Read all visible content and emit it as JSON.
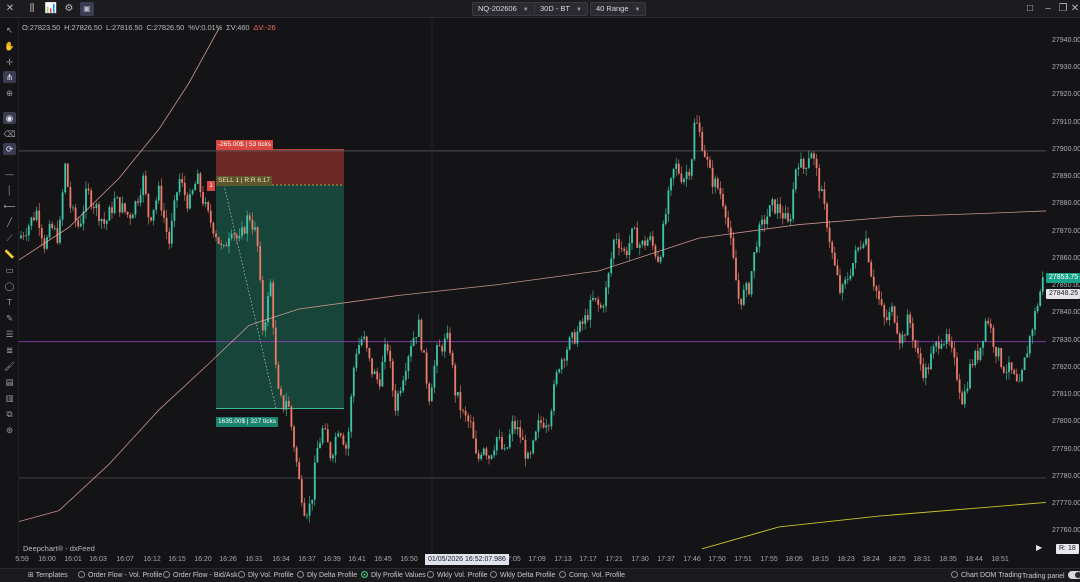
{
  "window": {
    "symbol": "NQ-202606",
    "period": "30D - BT",
    "bar_type": "40 Range"
  },
  "ohlc": {
    "open": "O:27823.50",
    "high": "H:27826.50",
    "low": "L:27816.50",
    "close": "C:27826.50",
    "pct": "%V:0.01%",
    "vol": "ΣV:460",
    "delta": "ΔV:-26"
  },
  "price_axis": {
    "labels": [
      "27940.00",
      "27930.00",
      "27920.00",
      "27910.00",
      "27900.00",
      "27890.00",
      "27880.00",
      "27870.00",
      "27860.00",
      "27850.00",
      "27840.00",
      "27830.00",
      "27820.00",
      "27810.00",
      "27800.00",
      "27790.00",
      "27780.00",
      "27770.00",
      "27760.00"
    ],
    "current_price": "27853.75",
    "cursor_price": "27848.25"
  },
  "time_axis": {
    "labels": [
      "5:59",
      "16:00",
      "16:01",
      "16:03",
      "16:07",
      "16:12",
      "16:15",
      "16:20",
      "16:26",
      "16:31",
      "16:34",
      "16:37",
      "16:39",
      "16:41",
      "16:45",
      "16:50",
      "17:05",
      "17:09",
      "17:13",
      "17:17",
      "17:21",
      "17:30",
      "17:37",
      "17:46",
      "17:50",
      "17:51",
      "17:55",
      "18:05",
      "18:15",
      "18:23",
      "18:24",
      "18:25",
      "18:31",
      "18:35",
      "18:44",
      "18:51"
    ],
    "cursor": "01/05/2026 16:52:07.986"
  },
  "trade": {
    "stop_label": "-265.00$ | 53 ticks",
    "entry_label": "SELL 1 | R:R 6.17",
    "target_label": "1635.00$ | 327 ticks",
    "qty_marker": "1"
  },
  "chart_data": {
    "type": "candlestick",
    "instrument": "NQ-202606",
    "ylim": [
      27755,
      27945
    ],
    "x_range": [
      "15:59",
      "18:52"
    ],
    "horizontal_lines": [
      27900,
      27830,
      27780
    ],
    "trade": {
      "side": "SELL",
      "entry": 27887.5,
      "stop": 27900.5,
      "target": 27805.5,
      "rr": 6.17
    },
    "close_path": [
      [
        0,
        27868
      ],
      [
        8,
        27872
      ],
      [
        18,
        27878
      ],
      [
        26,
        27865
      ],
      [
        32,
        27872
      ],
      [
        40,
        27868
      ],
      [
        46,
        27895
      ],
      [
        52,
        27878
      ],
      [
        60,
        27872
      ],
      [
        68,
        27885
      ],
      [
        76,
        27880
      ],
      [
        86,
        27873
      ],
      [
        96,
        27882
      ],
      [
        110,
        27876
      ],
      [
        118,
        27882
      ],
      [
        124,
        27890
      ],
      [
        130,
        27875
      ],
      [
        140,
        27885
      ],
      [
        150,
        27866
      ],
      [
        160,
        27890
      ],
      [
        170,
        27880
      ],
      [
        178,
        27890
      ],
      [
        188,
        27877
      ],
      [
        196,
        27871
      ],
      [
        204,
        27862
      ],
      [
        212,
        27873
      ],
      [
        220,
        27866
      ],
      [
        230,
        27877
      ],
      [
        238,
        27868
      ],
      [
        244,
        27834
      ],
      [
        252,
        27852
      ],
      [
        258,
        27812
      ],
      [
        264,
        27806
      ],
      [
        268,
        27810
      ],
      [
        274,
        27795
      ],
      [
        280,
        27779
      ],
      [
        286,
        27768
      ],
      [
        292,
        27770
      ],
      [
        298,
        27790
      ],
      [
        304,
        27798
      ],
      [
        312,
        27788
      ],
      [
        320,
        27800
      ],
      [
        328,
        27790
      ],
      [
        336,
        27826
      ],
      [
        344,
        27832
      ],
      [
        352,
        27820
      ],
      [
        360,
        27815
      ],
      [
        368,
        27830
      ],
      [
        376,
        27806
      ],
      [
        384,
        27818
      ],
      [
        392,
        27830
      ],
      [
        400,
        27836
      ],
      [
        410,
        27810
      ],
      [
        418,
        27826
      ],
      [
        424,
        27829
      ],
      [
        430,
        27831
      ],
      [
        436,
        27812
      ],
      [
        444,
        27803
      ],
      [
        452,
        27799
      ],
      [
        458,
        27785
      ],
      [
        464,
        27793
      ],
      [
        470,
        27788
      ],
      [
        478,
        27795
      ],
      [
        486,
        27788
      ],
      [
        494,
        27800
      ],
      [
        502,
        27795
      ],
      [
        510,
        27785
      ],
      [
        520,
        27800
      ],
      [
        530,
        27802
      ],
      [
        540,
        27822
      ],
      [
        548,
        27828
      ],
      [
        558,
        27833
      ],
      [
        566,
        27838
      ],
      [
        574,
        27845
      ],
      [
        582,
        27842
      ],
      [
        588,
        27850
      ],
      [
        596,
        27870
      ],
      [
        606,
        27862
      ],
      [
        614,
        27870
      ],
      [
        622,
        27865
      ],
      [
        630,
        27868
      ],
      [
        640,
        27860
      ],
      [
        648,
        27880
      ],
      [
        656,
        27895
      ],
      [
        664,
        27890
      ],
      [
        672,
        27895
      ],
      [
        676,
        27912
      ],
      [
        684,
        27902
      ],
      [
        692,
        27890
      ],
      [
        700,
        27886
      ],
      [
        706,
        27880
      ],
      [
        712,
        27865
      ],
      [
        720,
        27845
      ],
      [
        730,
        27850
      ],
      [
        738,
        27868
      ],
      [
        746,
        27875
      ],
      [
        754,
        27880
      ],
      [
        762,
        27878
      ],
      [
        770,
        27872
      ],
      [
        778,
        27898
      ],
      [
        784,
        27893
      ],
      [
        792,
        27901
      ],
      [
        800,
        27888
      ],
      [
        808,
        27874
      ],
      [
        814,
        27860
      ],
      [
        822,
        27847
      ],
      [
        830,
        27855
      ],
      [
        838,
        27863
      ],
      [
        846,
        27870
      ],
      [
        852,
        27856
      ],
      [
        860,
        27845
      ],
      [
        866,
        27837
      ],
      [
        874,
        27842
      ],
      [
        882,
        27830
      ],
      [
        890,
        27839
      ],
      [
        898,
        27825
      ],
      [
        906,
        27818
      ],
      [
        914,
        27826
      ],
      [
        922,
        27832
      ],
      [
        930,
        27829
      ],
      [
        938,
        27818
      ],
      [
        944,
        27808
      ],
      [
        952,
        27822
      ],
      [
        960,
        27826
      ],
      [
        968,
        27840
      ],
      [
        976,
        27828
      ],
      [
        984,
        27821
      ],
      [
        992,
        27819
      ],
      [
        1000,
        27812
      ],
      [
        1008,
        27827
      ],
      [
        1016,
        27840
      ],
      [
        1024,
        27853
      ]
    ]
  },
  "watermark": "Deepchart® - dxFeed",
  "rbadge": "R: 18",
  "bottom_bar": {
    "templates": "Templates",
    "profiles": [
      "Order Flow - Vol. Profile",
      "Order Flow - Bid/Ask",
      "Dly Vol. Profile",
      "Dly Delta Profile",
      "Dly Profile Values",
      "Wkly Vol. Profile",
      "Wkly Delta Profile",
      "Comp. Vol. Profile"
    ],
    "active_profile_index": 4,
    "chart_dom": "Chart DOM Trading",
    "trading_panel": "Trading panel"
  },
  "colors": {
    "background": "#141416",
    "bull": "#3cc8a8",
    "bear": "#ec7b6c",
    "stop_zone": "#7a2b28",
    "target_zone": "#184a3e",
    "vwap": "#e7a8a0",
    "purple_line": "#8a3fbf",
    "yellow_line": "#c9c42a",
    "price_tag": "#17a38c"
  }
}
